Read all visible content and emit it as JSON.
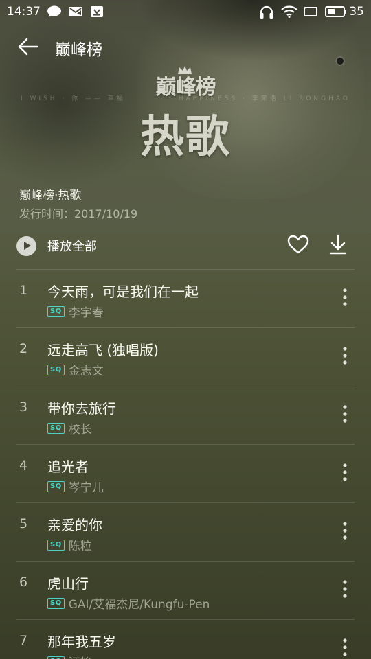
{
  "status_bar": {
    "time": "14:37",
    "battery": "35",
    "icons": [
      "chat-bubble-icon",
      "mail-icon",
      "shield-download-icon",
      "headphones-icon",
      "wifi-icon",
      "screen-icon",
      "battery-icon"
    ]
  },
  "header": {
    "title": "巅峰榜",
    "back_icon": "arrow-left-icon"
  },
  "hero": {
    "logo_text": "巅峰榜",
    "big_text": "热歌",
    "strip_left": "I  WISH  ·  你 —— 幸福",
    "strip_right": "HAPPINESS  ·  李荣浩  LI RONGHAO"
  },
  "album": {
    "name": "巅峰榜·热歌",
    "release": "发行时间：2017/10/19"
  },
  "actions": {
    "play_all_label": "播放全部",
    "favorite_icon": "heart-outline-icon",
    "download_icon": "download-icon"
  },
  "songs": [
    {
      "rank": "1",
      "title": "今天雨，可是我们在一起",
      "quality": "SQ",
      "artist": "李宇春"
    },
    {
      "rank": "2",
      "title": "远走高飞 (独唱版)",
      "quality": "SQ",
      "artist": "金志文"
    },
    {
      "rank": "3",
      "title": "带你去旅行",
      "quality": "SQ",
      "artist": "校长"
    },
    {
      "rank": "4",
      "title": "追光者",
      "quality": "SQ",
      "artist": "岑宁儿"
    },
    {
      "rank": "5",
      "title": "亲爱的你",
      "quality": "SQ",
      "artist": "陈粒"
    },
    {
      "rank": "6",
      "title": "虎山行",
      "quality": "SQ",
      "artist": "GAI/艾福杰尼/Kungfu-Pen"
    },
    {
      "rank": "7",
      "title": "那年我五岁",
      "quality": "SQ",
      "artist": "汪峰"
    }
  ],
  "colors": {
    "accent_sq": "#4fd1c5",
    "background": "#4f5438"
  }
}
